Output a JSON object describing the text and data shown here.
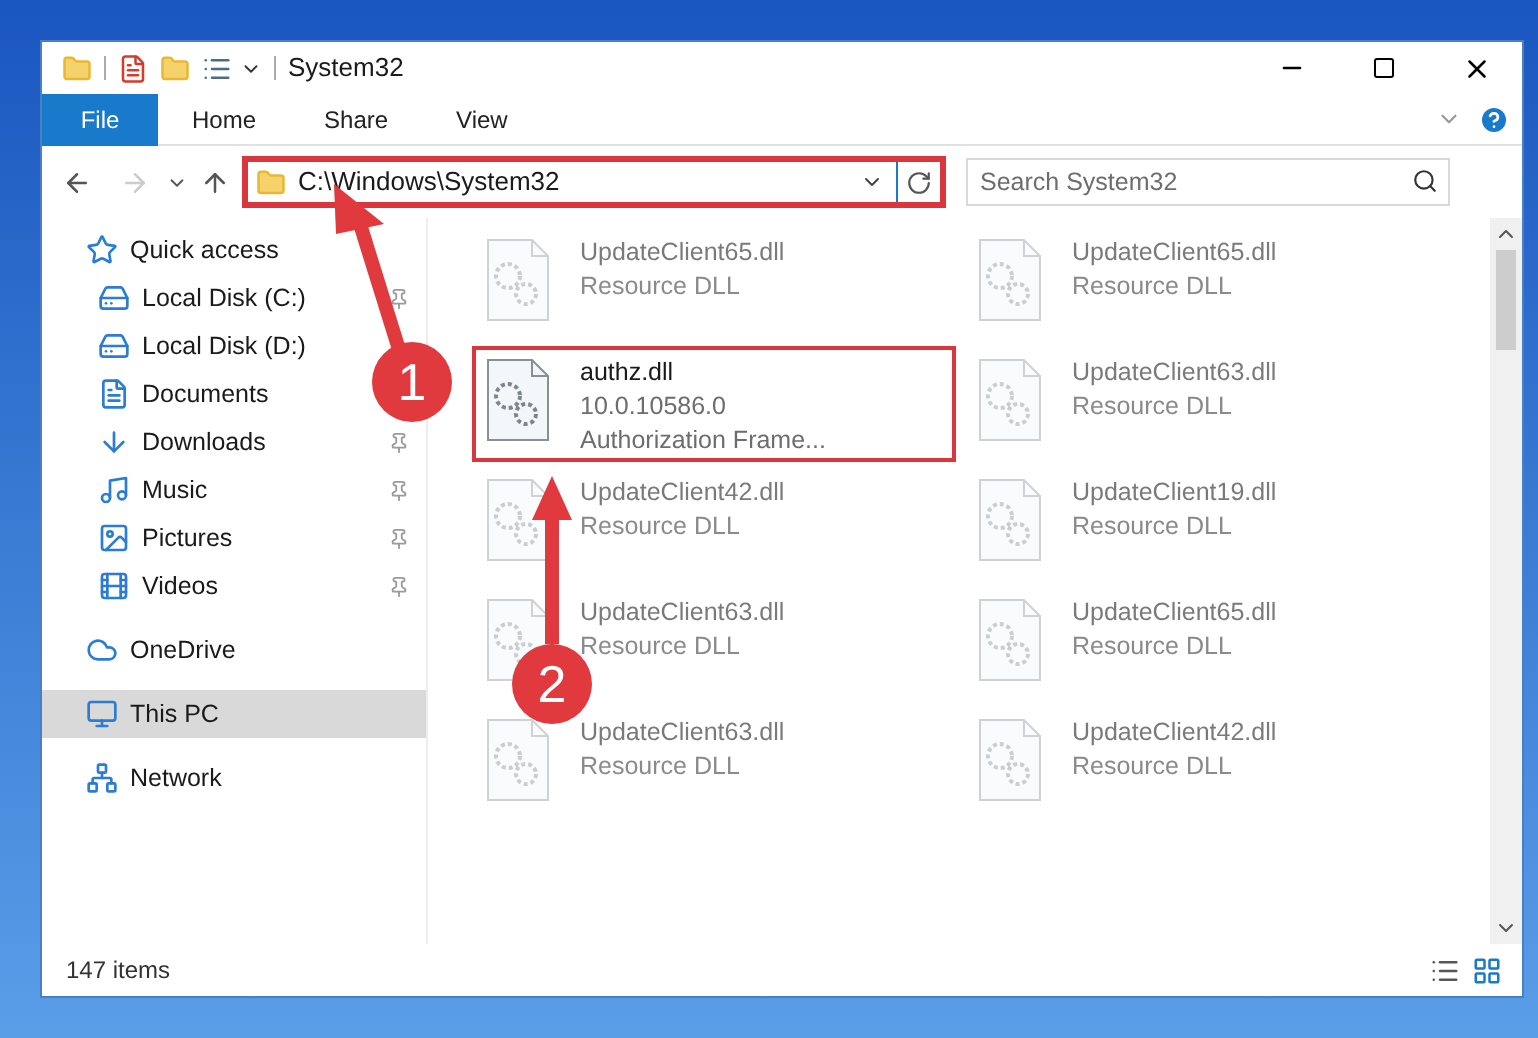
{
  "window": {
    "title": "System32"
  },
  "ribbon_tabs": [
    {
      "label": "File",
      "selected": true
    },
    {
      "label": "Home",
      "selected": false
    },
    {
      "label": "Share",
      "selected": false
    },
    {
      "label": "View",
      "selected": false
    }
  ],
  "address_bar": {
    "path": "C:\\Windows\\System32",
    "highlighted": true
  },
  "search": {
    "placeholder": "Search System32"
  },
  "sidebar": {
    "items": [
      {
        "label": "Quick access",
        "selected": false,
        "children": [
          {
            "label": "Local Disk (C:)",
            "pinned": true,
            "selected": false
          },
          {
            "label": "Local Disk (D:)",
            "pinned": false,
            "selected": false
          },
          {
            "label": "Documents",
            "pinned": false,
            "selected": false
          },
          {
            "label": "Downloads",
            "pinned": true,
            "selected": false
          },
          {
            "label": "Music",
            "pinned": true,
            "selected": false
          },
          {
            "label": "Pictures",
            "pinned": true,
            "selected": false
          },
          {
            "label": "Videos",
            "pinned": true,
            "selected": false
          }
        ]
      },
      {
        "label": "OneDrive",
        "selected": false
      },
      {
        "label": "This PC",
        "selected": true
      },
      {
        "label": "Network",
        "selected": false
      }
    ]
  },
  "files": [
    {
      "name": "UpdateClient65.dll",
      "line2": "Resource DLL",
      "kind": "blurred",
      "highlighted": false
    },
    {
      "name": "UpdateClient65.dll",
      "line2": "Resource DLL",
      "kind": "blurred",
      "highlighted": false
    },
    {
      "name": "authz.dll",
      "line2": "10.0.10586.0",
      "line3": "Authorization Frame...",
      "kind": "clear",
      "highlighted": true
    },
    {
      "name": "UpdateClient63.dll",
      "line2": "Resource DLL",
      "kind": "blurred",
      "highlighted": false
    },
    {
      "name": "UpdateClient42.dll",
      "line2": "Resource DLL",
      "kind": "blurred",
      "highlighted": false
    },
    {
      "name": "UpdateClient19.dll",
      "line2": "Resource DLL",
      "kind": "blurred",
      "highlighted": false
    },
    {
      "name": "UpdateClient63.dll",
      "line2": "Resource DLL",
      "kind": "blurred",
      "highlighted": false
    },
    {
      "name": "UpdateClient65.dll",
      "line2": "Resource DLL",
      "kind": "blurred",
      "highlighted": false
    },
    {
      "name": "UpdateClient63.dll",
      "line2": "Resource DLL",
      "kind": "blurred",
      "highlighted": false
    },
    {
      "name": "UpdateClient42.dll",
      "line2": "Resource DLL",
      "kind": "blurred",
      "highlighted": false
    }
  ],
  "status_bar": {
    "item_count": "147 items"
  },
  "callouts": [
    {
      "number": "1"
    },
    {
      "number": "2"
    }
  ]
}
